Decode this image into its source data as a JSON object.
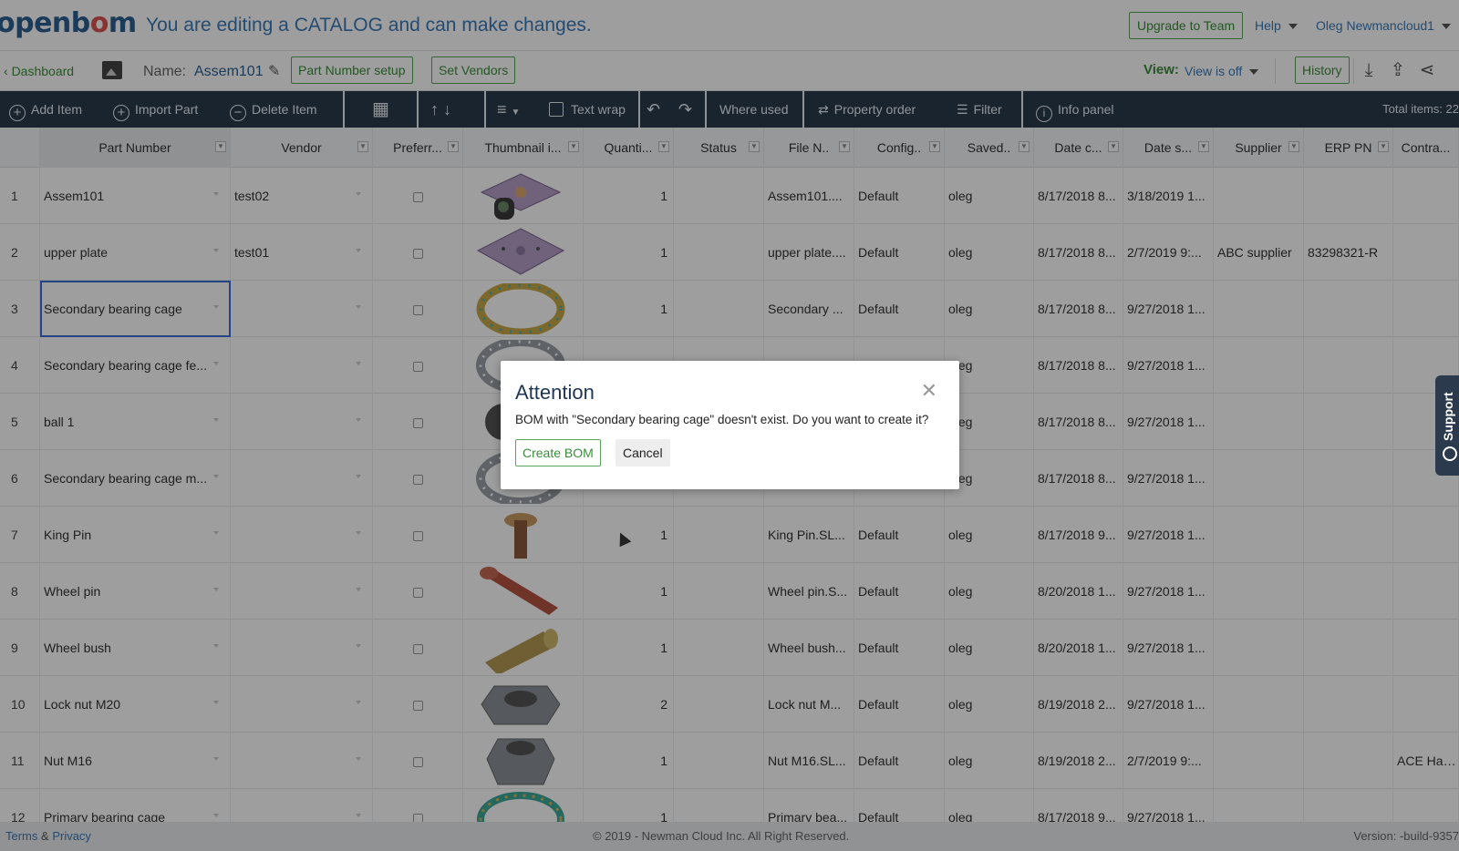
{
  "header": {
    "logo": "openbom",
    "message": "You are editing a CATALOG and can make changes.",
    "upgrade_label": "Upgrade to Team",
    "help_label": "Help",
    "user_label": "Oleg Newmancloud1"
  },
  "subbar": {
    "dashboard_label": "Dashboard",
    "name_label": "Name:",
    "name_value": "Assem101",
    "part_number_setup_label": "Part Number setup",
    "set_vendors_label": "Set Vendors",
    "view_label": "View:",
    "view_value": "View is off",
    "history_label": "History"
  },
  "toolbar": {
    "add_item": "Add Item",
    "import_part": "Import Part",
    "delete_item": "Delete Item",
    "text_wrap": "Text wrap",
    "where_used": "Where used",
    "property_order": "Property order",
    "filter": "Filter",
    "info_panel": "Info panel",
    "total_items": "Total items: 22"
  },
  "columns": [
    "",
    "Part Number",
    "Vendor",
    "Preferr...",
    "Thumbnail i...",
    "Quanti...",
    "Status",
    "File N..",
    "Config..",
    "Saved..",
    "Date c...",
    "Date s...",
    "Supplier",
    "ERP PN",
    "Contra..."
  ],
  "rows": [
    {
      "idx": "1",
      "part": "Assem101",
      "vendor": "test02",
      "qty": "1",
      "file": "Assem101....",
      "config": "Default",
      "saved": "oleg",
      "date_c": "8/17/2018 8...",
      "date_s": "3/18/2019 1...",
      "supplier": "",
      "erp": "",
      "contra": "",
      "thumb": "plate-assembly"
    },
    {
      "idx": "2",
      "part": "upper plate",
      "vendor": "test01",
      "qty": "1",
      "file": "upper plate....",
      "config": "Default",
      "saved": "oleg",
      "date_c": "8/17/2018 8...",
      "date_s": "2/7/2019 9:...",
      "supplier": "ABC supplier",
      "erp": "83298321-R",
      "contra": "",
      "thumb": "plate"
    },
    {
      "idx": "3",
      "part": "Secondary bearing cage",
      "vendor": "",
      "qty": "1",
      "file": "Secondary ...",
      "config": "Default",
      "saved": "oleg",
      "date_c": "8/17/2018 8...",
      "date_s": "9/27/2018 1...",
      "supplier": "",
      "erp": "",
      "contra": "",
      "thumb": "ring-gold"
    },
    {
      "idx": "4",
      "part": "Secondary bearing cage fe...",
      "vendor": "",
      "qty": "",
      "file": "",
      "config": "",
      "saved": "oleg",
      "date_c": "8/17/2018 8...",
      "date_s": "9/27/2018 1...",
      "supplier": "",
      "erp": "",
      "contra": "",
      "thumb": "ring-grey"
    },
    {
      "idx": "5",
      "part": "ball 1",
      "vendor": "",
      "qty": "",
      "file": "",
      "config": "",
      "saved": "oleg",
      "date_c": "8/17/2018 8...",
      "date_s": "9/27/2018 1...",
      "supplier": "",
      "erp": "",
      "contra": "",
      "thumb": "ball"
    },
    {
      "idx": "6",
      "part": "Secondary bearing cage m...",
      "vendor": "",
      "qty": "",
      "file": "",
      "config": "",
      "saved": "oleg",
      "date_c": "8/17/2018 8...",
      "date_s": "9/27/2018 1...",
      "supplier": "",
      "erp": "",
      "contra": "",
      "thumb": "ring-grey"
    },
    {
      "idx": "7",
      "part": "King Pin",
      "vendor": "",
      "qty": "1",
      "file": "King Pin.SL...",
      "config": "Default",
      "saved": "oleg",
      "date_c": "8/17/2018 9...",
      "date_s": "9/27/2018 1...",
      "supplier": "",
      "erp": "",
      "contra": "",
      "thumb": "pin"
    },
    {
      "idx": "8",
      "part": "Wheel pin",
      "vendor": "",
      "qty": "1",
      "file": "Wheel pin.S...",
      "config": "Default",
      "saved": "oleg",
      "date_c": "8/20/2018 1...",
      "date_s": "9/27/2018 1...",
      "supplier": "",
      "erp": "",
      "contra": "",
      "thumb": "bolt"
    },
    {
      "idx": "9",
      "part": "Wheel bush",
      "vendor": "",
      "qty": "1",
      "file": "Wheel bush...",
      "config": "Default",
      "saved": "oleg",
      "date_c": "8/20/2018 1...",
      "date_s": "9/27/2018 1...",
      "supplier": "",
      "erp": "",
      "contra": "",
      "thumb": "bush"
    },
    {
      "idx": "10",
      "part": "Lock nut M20",
      "vendor": "",
      "qty": "2",
      "file": "Lock nut M...",
      "config": "Default",
      "saved": "oleg",
      "date_c": "8/19/2018 2...",
      "date_s": "9/27/2018 1...",
      "supplier": "",
      "erp": "",
      "contra": "",
      "thumb": "nut"
    },
    {
      "idx": "11",
      "part": "Nut M16",
      "vendor": "",
      "qty": "1",
      "file": "Nut M16.SL...",
      "config": "Default",
      "saved": "oleg",
      "date_c": "8/19/2018 2...",
      "date_s": "2/7/2019 9:...",
      "supplier": "",
      "erp": "",
      "contra": "ACE Hardw",
      "thumb": "nut-tall"
    },
    {
      "idx": "12",
      "part": "Primary bearing cage",
      "vendor": "",
      "qty": "1",
      "file": "Primary bea...",
      "config": "Default",
      "saved": "oleg",
      "date_c": "8/17/2018 9...",
      "date_s": "9/27/2018 1...",
      "supplier": "",
      "erp": "",
      "contra": "",
      "thumb": "ring-teal"
    }
  ],
  "footer": {
    "terms": "Terms",
    "amp": "&",
    "privacy": "Privacy",
    "copyright": "© 2019 - Newman Cloud Inc. All Right Reserved.",
    "version": "Version: -build-9357"
  },
  "support_label": "Support",
  "modal": {
    "title": "Attention",
    "message": "BOM with \"Secondary bearing cage\" doesn't exist. Do you want to create it?",
    "create_label": "Create BOM",
    "cancel_label": "Cancel"
  },
  "colors": {
    "toolbar_bg": "#2b3a4d",
    "accent_green": "#3b8d3b",
    "link_blue": "#3a7ab8"
  }
}
